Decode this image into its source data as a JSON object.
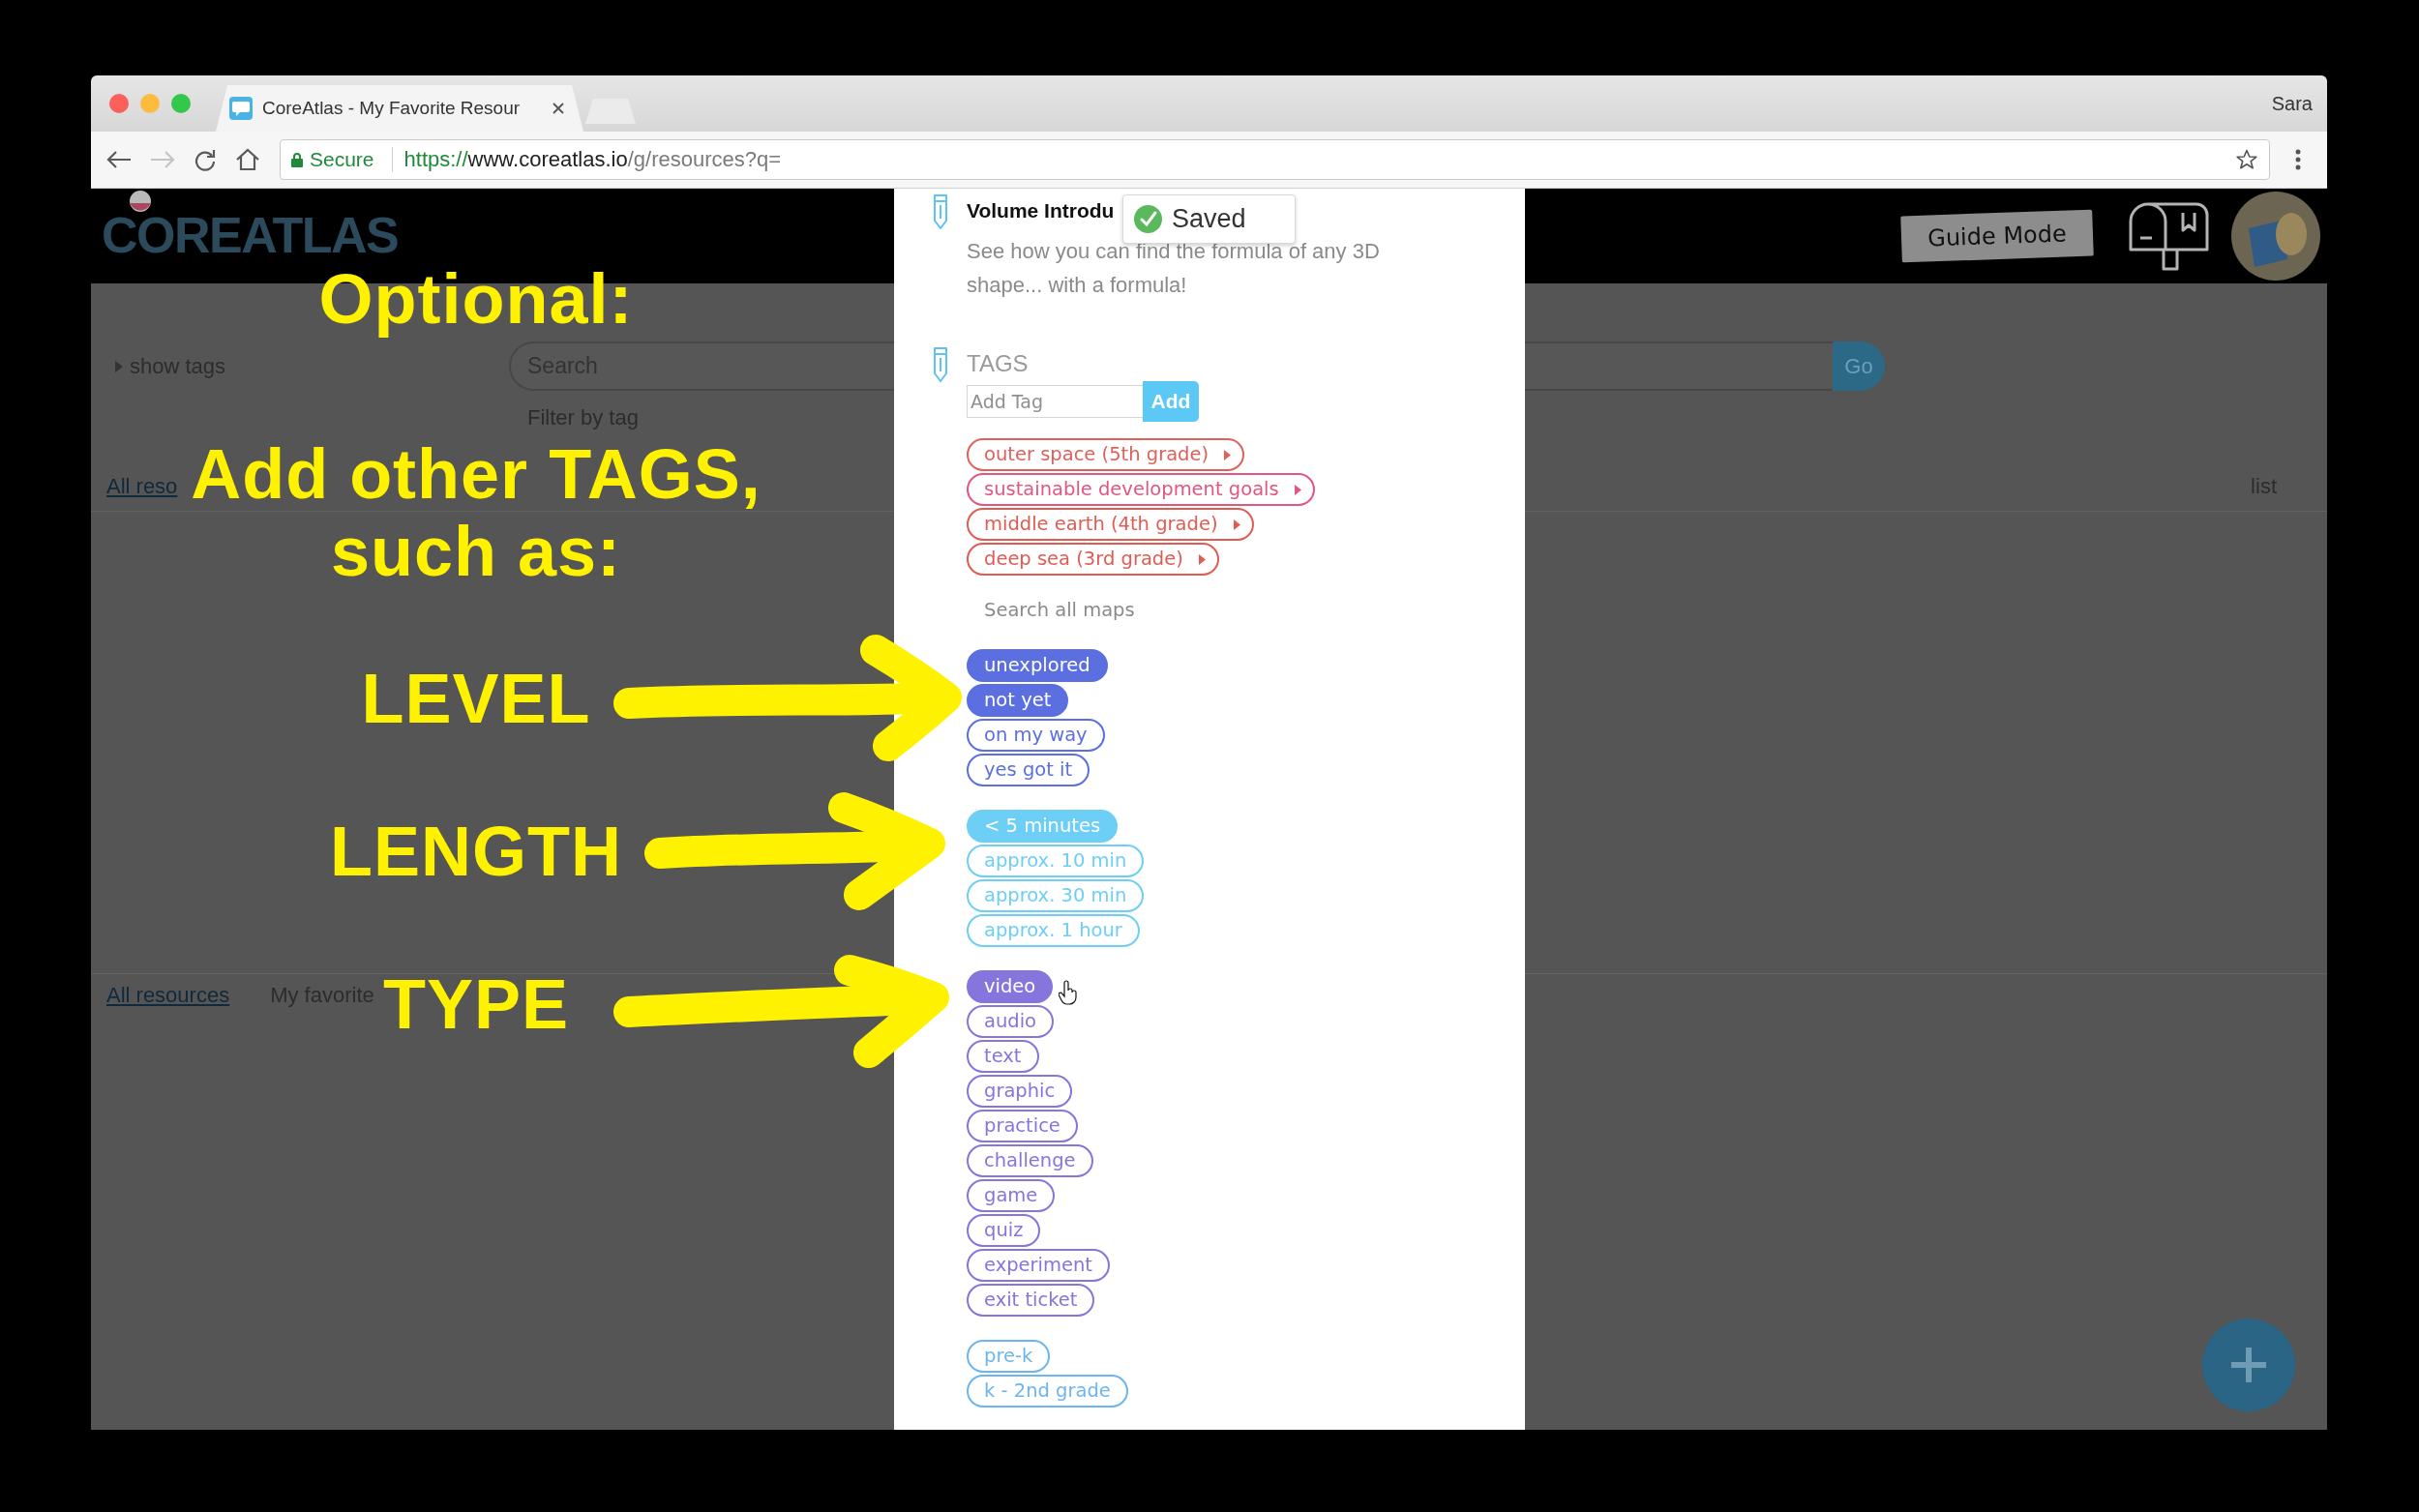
{
  "browser": {
    "tab_title": "CoreAtlas - My Favorite Resour",
    "profile_name": "Sara",
    "forward_disabled": true,
    "security_label": "Secure",
    "url": {
      "scheme": "https://",
      "host": "www.coreatlas.io",
      "path": "/g/resources?q="
    }
  },
  "header": {
    "logo": "COREATLAS",
    "guide_button": "Guide Mode"
  },
  "page": {
    "show_tags": "show tags",
    "search": {
      "placeholder": "Search"
    },
    "go_button": "Go",
    "filter_label": "Filter by tag",
    "top_row": {
      "link": "All reso",
      "view_label": "list"
    },
    "bottom_row": {
      "link": "All resources",
      "favorites": "My favorite"
    }
  },
  "modal": {
    "title": "Volume Introdu",
    "toast": "Saved",
    "description": "See how you can find the formula of any 3D shape... with a formula!",
    "tags_heading": "TAGS",
    "tag_input": {
      "placeholder": "Add Tag"
    },
    "add_button": "Add",
    "map_tags": [
      {
        "label": "outer space (5th grade)",
        "color": "#e0615a"
      },
      {
        "label": "sustainable development goals",
        "color": "#e2567f"
      },
      {
        "label": "middle earth (4th grade)",
        "color": "#e05c53"
      },
      {
        "label": "deep sea (3rd grade)",
        "color": "#e05c53"
      }
    ],
    "search_maps_link": "Search all maps",
    "tag_groups": [
      {
        "color": "#5b6fe0",
        "tags": [
          {
            "label": "unexplored",
            "selected": true
          },
          {
            "label": "not yet",
            "selected": true
          },
          {
            "label": "on my way",
            "selected": false
          },
          {
            "label": "yes got it",
            "selected": false
          }
        ]
      },
      {
        "color": "#6dcff6",
        "tags": [
          {
            "label": "< 5 minutes",
            "selected": true
          },
          {
            "label": "approx. 10 min",
            "selected": false
          },
          {
            "label": "approx. 30 min",
            "selected": false
          },
          {
            "label": "approx. 1 hour",
            "selected": false
          }
        ]
      },
      {
        "color": "#8575dc",
        "tags": [
          {
            "label": "video",
            "selected": true
          },
          {
            "label": "audio",
            "selected": false
          },
          {
            "label": "text",
            "selected": false
          },
          {
            "label": "graphic",
            "selected": false
          },
          {
            "label": "practice",
            "selected": false
          },
          {
            "label": "challenge",
            "selected": false
          },
          {
            "label": "game",
            "selected": false
          },
          {
            "label": "quiz",
            "selected": false
          },
          {
            "label": "experiment",
            "selected": false
          },
          {
            "label": "exit ticket",
            "selected": false
          }
        ]
      },
      {
        "color": "#6cb5ee",
        "tags": [
          {
            "label": "pre-k",
            "selected": false
          },
          {
            "label": "k - 2nd grade",
            "selected": false
          }
        ]
      }
    ]
  },
  "annotation": {
    "title": "Optional:",
    "subtitle": "Add other TAGS, such as:",
    "pointers": [
      {
        "label": "LEVEL"
      },
      {
        "label": "LENGTH"
      },
      {
        "label": "TYPE"
      }
    ]
  }
}
